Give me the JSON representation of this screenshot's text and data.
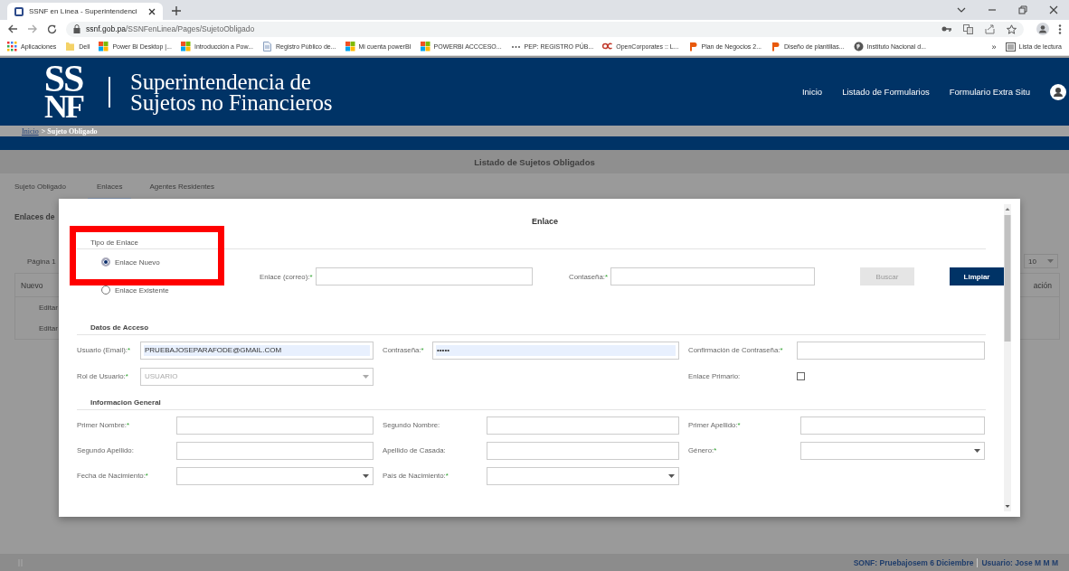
{
  "browser": {
    "tab_title": "SSNF en Línea - Superintendenci",
    "url_host": "ssnf.gob.pa",
    "url_path": "/SSNFenLinea/Pages/SujetoObligado",
    "bookmarks": [
      {
        "label": "Aplicaciones",
        "kind": "apps"
      },
      {
        "label": "Dell",
        "kind": "folder"
      },
      {
        "label": "Power BI Desktop |...",
        "kind": "tiles"
      },
      {
        "label": "Introducción a Pow...",
        "kind": "tiles"
      },
      {
        "label": "Registro Público de...",
        "kind": "doc"
      },
      {
        "label": "Mi cuenta powerBI",
        "kind": "tiles"
      },
      {
        "label": "POWERBI ACCCESO...",
        "kind": "tiles"
      },
      {
        "label": "PEP: REGISTRO PÚB...",
        "kind": "dots"
      },
      {
        "label": "OpenCorporates :: L...",
        "kind": "mark"
      },
      {
        "label": "Plan de Negocios 2...",
        "kind": "p"
      },
      {
        "label": "Diseño de plantillas...",
        "kind": "p"
      },
      {
        "label": "Instituto Nacional d...",
        "kind": "globe"
      }
    ],
    "more": "»",
    "reading_list": "Lista de lectura"
  },
  "header": {
    "logo_top": "SS",
    "logo_bottom": "NF",
    "title_lines": [
      "Superintendencia de",
      "Sujetos no Financieros"
    ],
    "nav": [
      "Inicio",
      "Listado de Formularios",
      "Formulario Extra Situ"
    ]
  },
  "breadcrumb": [
    {
      "label": "Inicio",
      "kind": "link"
    },
    {
      "label": "> Sujeto Obligado",
      "kind": "current"
    }
  ],
  "page": {
    "title": "Listado de Sujetos Obligados",
    "tabs": [
      {
        "label": "Sujeto Obligado",
        "selected": false
      },
      {
        "label": "Enlaces",
        "selected": true
      },
      {
        "label": "Agentes Residentes",
        "selected": false
      }
    ],
    "section_title": "Enlaces de",
    "pager": "Página 1",
    "page_size": "10",
    "columns": [
      "Nuevo",
      "ación"
    ],
    "rows": [
      "Editar",
      "Editar"
    ]
  },
  "modal": {
    "title": "Enlace",
    "link_type": {
      "legend": "Tipo de Enlace",
      "highlighted": true,
      "options": [
        {
          "label": "Enlace Nuevo",
          "selected": true
        },
        {
          "label": "Enlace Existente",
          "selected": false
        }
      ]
    },
    "search_fields": [
      {
        "kind": "text",
        "label": "Enlace (correo):",
        "mark": "*"
      },
      {
        "kind": "text",
        "label": "Contaseña:",
        "mark": "*"
      }
    ],
    "buttons": [
      {
        "label": "Buscar",
        "disabled": true
      },
      {
        "label": "Limpiar",
        "disabled": false
      }
    ],
    "sections": [
      {
        "title": "Datos de Acceso",
        "rows": [
          [
            {
              "kind": "text",
              "label": "Usuario (Email):",
              "mark": "*",
              "value": "PRUEBAJOSEPARAFODE@GMAIL.COM",
              "autofilled": true
            },
            {
              "kind": "text",
              "label": "Contraseña:",
              "mark": "*",
              "value": "•••••",
              "autofilled": true
            },
            {
              "kind": "text",
              "label": "Confirmación de Contraseña:",
              "mark": "*"
            }
          ],
          [
            {
              "kind": "select",
              "label": "Rol de Usuario:",
              "mark": "*",
              "value": "USUARIO",
              "disabled": true
            },
            {
              "kind": "empty"
            },
            {
              "kind": "checkbox",
              "label": "Enlace Primario:",
              "checked": false
            }
          ]
        ]
      },
      {
        "title": "Informacion General",
        "rows": [
          [
            {
              "kind": "text",
              "label": "Primer Nombre:",
              "mark": "*"
            },
            {
              "kind": "text",
              "label": "Segundo Nombre:"
            },
            {
              "kind": "text",
              "label": "Primer Apellido:",
              "mark": "*"
            }
          ],
          [
            {
              "kind": "text",
              "label": "Segundo Apellido:"
            },
            {
              "kind": "text",
              "label": "Apellido de Casada:"
            },
            {
              "kind": "select",
              "label": "Género:",
              "mark": "*"
            }
          ],
          [
            {
              "kind": "select",
              "label": "Fecha de Nacimiento:",
              "mark": "*"
            },
            {
              "kind": "select",
              "label": "País de Nacimiento:",
              "mark": "*"
            },
            {
              "kind": "empty"
            }
          ]
        ]
      }
    ]
  },
  "footer": {
    "system": "SONF: Pruebajosem 6 Diciembre",
    "user": "Usuario: Jose M M M"
  }
}
